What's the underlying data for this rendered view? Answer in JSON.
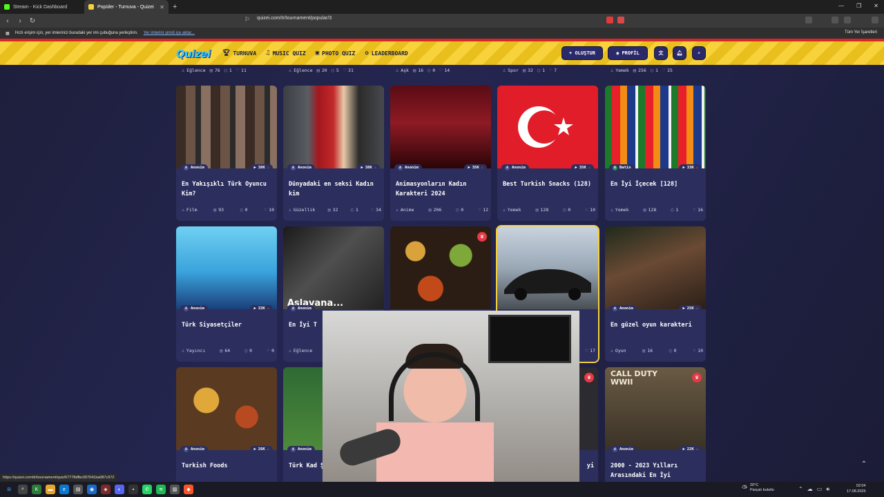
{
  "browser": {
    "tabs": [
      {
        "title": "Stream - Kick Dashboard",
        "active": false
      },
      {
        "title": "Popüler - Turnuva - Quizei",
        "active": true
      }
    ],
    "url": "quizei.com/tr/tournament/popular/3",
    "infobar": {
      "text": "Hızlı erişim için, yer imlerinizi buradaki yer imi çubuğuna yerleştirin.",
      "link": "Yer imlerini şimdi içe aktar...",
      "right": "Tüm Yer İşaretleri"
    },
    "status_url": "https://quizei.com/tr/tournament/quiz/67778dfbc097041ba087c972"
  },
  "site": {
    "logo": "Quizei",
    "nav": [
      {
        "label": "TURNUVA",
        "icon": "trophy-icon"
      },
      {
        "label": "MUSIC QUIZ",
        "icon": "music-icon"
      },
      {
        "label": "PHOTO QUIZ",
        "icon": "camera-icon"
      },
      {
        "label": "LEADERBOARD",
        "icon": "medal-icon"
      }
    ],
    "create_label": "+ OLUŞTUR",
    "profile_label": "PROFİL"
  },
  "prev_row_meta": [
    {
      "category": "Eğlence",
      "questions": "76",
      "comments": "1",
      "likes": "11"
    },
    {
      "category": "Eğlence",
      "questions": "20",
      "comments": "5",
      "likes": "31"
    },
    {
      "category": "Aşk",
      "questions": "16",
      "comments": "0",
      "likes": "14"
    },
    {
      "category": "Spor",
      "questions": "32",
      "comments": "1",
      "likes": "7"
    },
    {
      "category": "Yemek",
      "questions": "256",
      "comments": "1",
      "likes": "25"
    }
  ],
  "cards": [
    {
      "author": "Anonim",
      "plays": "38K",
      "title": "En Yakışıklı Türk Oyuncu Kim?",
      "category": "Film",
      "questions": "93",
      "comments": "0",
      "likes": "10"
    },
    {
      "author": "Anonim",
      "plays": "38K",
      "title": "Dünyadaki en seksi Kadın kim",
      "category": "Güzellik",
      "questions": "32",
      "comments": "1",
      "likes": "34"
    },
    {
      "author": "Anonim",
      "plays": "35K",
      "title": "Animasyonların Kadın Karakteri 2024",
      "category": "Anime",
      "questions": "206",
      "comments": "0",
      "likes": "12"
    },
    {
      "author": "Anonim",
      "plays": "35K",
      "title": "Best Turkish Snacks (128)",
      "category": "Yemek",
      "questions": "128",
      "comments": "0",
      "likes": "10"
    },
    {
      "author": "Batin",
      "plays": "33K",
      "title": "En İyi İçecek [128]",
      "category": "Yemek",
      "questions": "128",
      "comments": "1",
      "likes": "16"
    },
    {
      "author": "Anonim",
      "plays": "33K",
      "title": "Türk Siyasetçiler",
      "category": "Yayıncı",
      "questions": "64",
      "comments": "0",
      "likes": "0"
    },
    {
      "author": "Anonim",
      "plays": "",
      "title": "En İyi T",
      "category": "Eğlence",
      "questions": "",
      "comments": "",
      "likes": "",
      "overlay_text": "Aslavana..."
    },
    {
      "author": "",
      "plays": "",
      "title": "",
      "category": "",
      "questions": "",
      "comments": "",
      "likes": ""
    },
    {
      "author": "",
      "plays": "",
      "title": "",
      "category": "",
      "questions": "",
      "comments": "",
      "likes": "17"
    },
    {
      "author": "Anonim",
      "plays": "25K",
      "title": "En güzel oyun karakteri",
      "category": "Oyun",
      "questions": "16",
      "comments": "0",
      "likes": "10"
    },
    {
      "author": "Anonim",
      "plays": "26K",
      "title": "Turkish Foods",
      "category": "",
      "questions": "",
      "comments": "",
      "likes": ""
    },
    {
      "author": "Anonim",
      "plays": "",
      "title": "Türk Kad Şampiyon",
      "category": "",
      "questions": "",
      "comments": "",
      "likes": ""
    },
    {
      "author": "",
      "plays": "",
      "title": "yi",
      "category": "",
      "questions": "",
      "comments": "",
      "likes": ""
    },
    {
      "author": "Anonim",
      "plays": "22K",
      "title": "2000 - 2023 Yılları Arasındaki En İyi",
      "category": "",
      "questions": "",
      "comments": "",
      "likes": ""
    }
  ],
  "cod_label": "CALL DUTY WWII",
  "taskbar": {
    "weather_temp": "20°C",
    "weather_desc": "Parçalı bulutlu",
    "time": "02:04",
    "date": "17.08.2025"
  }
}
